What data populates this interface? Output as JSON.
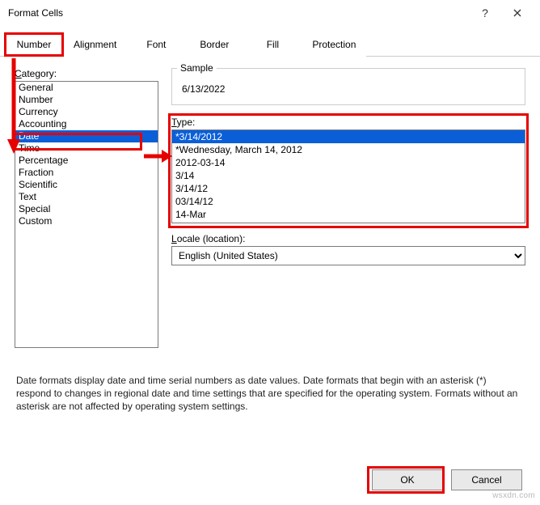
{
  "title": "Format Cells",
  "tabs": [
    "Number",
    "Alignment",
    "Font",
    "Border",
    "Fill",
    "Protection"
  ],
  "activeTabIndex": 0,
  "categoryLabel": "Category:",
  "categories": [
    "General",
    "Number",
    "Currency",
    "Accounting",
    "Date",
    "Time",
    "Percentage",
    "Fraction",
    "Scientific",
    "Text",
    "Special",
    "Custom"
  ],
  "selectedCategoryIndex": 4,
  "sampleLabel": "Sample",
  "sampleValue": "6/13/2022",
  "typeLabel": "Type:",
  "types": [
    "*3/14/2012",
    "*Wednesday, March 14, 2012",
    "2012-03-14",
    "3/14",
    "3/14/12",
    "03/14/12",
    "14-Mar"
  ],
  "selectedTypeIndex": 0,
  "localeLabel": "Locale (location):",
  "localeValue": "English (United States)",
  "description": "Date formats display date and time serial numbers as date values.  Date formats that begin with an asterisk (*) respond to changes in regional date and time settings that are specified for the operating system.  Formats without an asterisk are not affected by operating system settings.",
  "buttons": {
    "ok": "OK",
    "cancel": "Cancel"
  },
  "watermark": "wsxdn.com"
}
